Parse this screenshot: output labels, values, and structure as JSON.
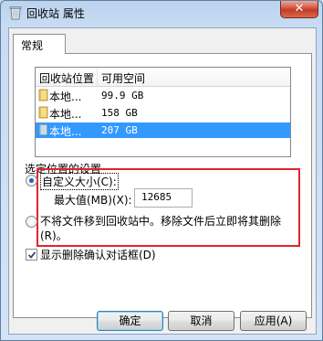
{
  "window": {
    "title": "回收站 属性",
    "close_label": "✕"
  },
  "tabs": [
    {
      "label": "常规",
      "selected": true
    }
  ],
  "listview": {
    "columns": [
      "回收站位置",
      "可用空间"
    ],
    "rows": [
      {
        "location": "本地...",
        "free_space": "99.9 GB",
        "selected": false
      },
      {
        "location": "本地...",
        "free_space": "158 GB",
        "selected": false
      },
      {
        "location": "本地...",
        "free_space": "207 GB",
        "selected": true
      }
    ]
  },
  "settings": {
    "group_label": "选定位置的设置",
    "custom_size_label": "自定义大小(C):",
    "custom_size_selected": true,
    "max_size_label": "最大值(MB)(X):",
    "max_size_value": "12685",
    "delete_immediately_label": "不将文件移到回收站中。移除文件后立即将其删除(R)。",
    "delete_immediately_selected": false,
    "confirm_label": "显示删除确认对话框(D)",
    "confirm_checked": true
  },
  "buttons": {
    "ok": "确定",
    "cancel": "取消",
    "apply": "应用(A)"
  },
  "colors": {
    "selection": "#3399ff",
    "highlight_box": "#e3232b"
  }
}
